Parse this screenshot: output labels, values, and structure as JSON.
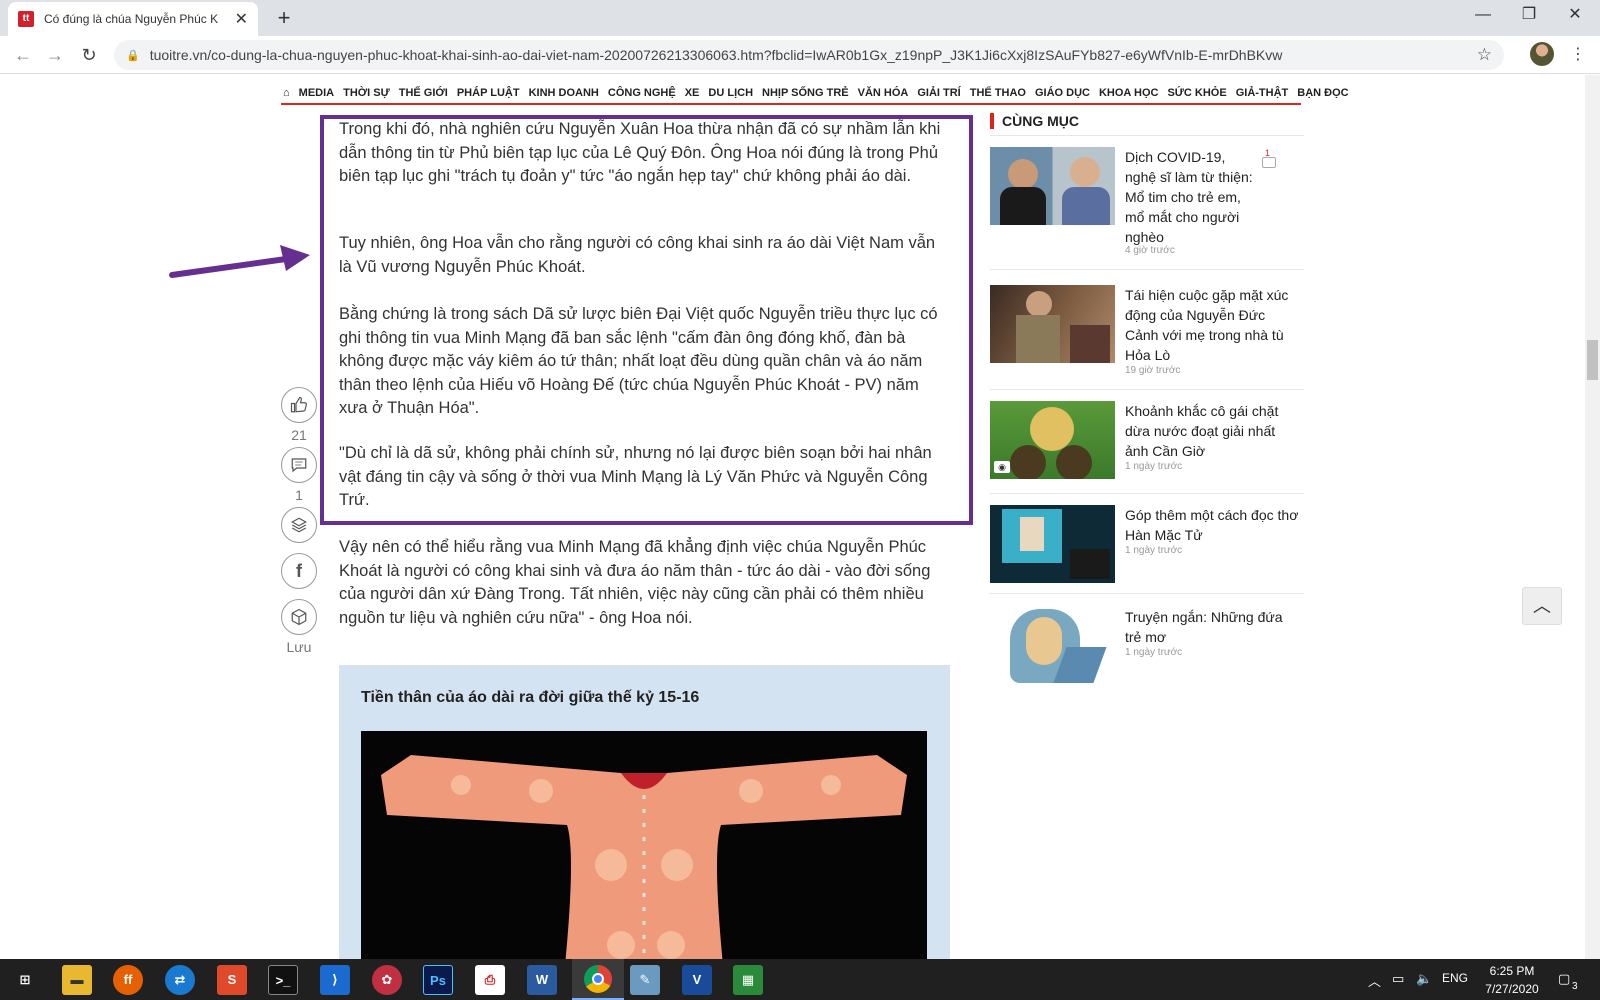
{
  "browser": {
    "tab_title": "Có đúng là chúa Nguyễn Phúc K",
    "url": "tuoitre.vn/co-dung-la-chua-nguyen-phuc-khoat-khai-sinh-ao-dai-viet-nam-20200726213306063.htm?fbclid=IwAR0b1Gx_z19npP_J3K1Ji6cXxj8IzSAuFYb827-e6yWfVnIb-E-mrDhBKvw"
  },
  "nav": {
    "items": [
      "MEDIA",
      "THỜI SỰ",
      "THẾ GIỚI",
      "PHÁP LUẬT",
      "KINH DOANH",
      "CÔNG NGHỆ",
      "XE",
      "DU LỊCH",
      "NHỊP SỐNG TRẺ",
      "VĂN HÓA",
      "GIẢI TRÍ",
      "THỂ THAO",
      "GIÁO DỤC",
      "KHOA HỌC",
      "SỨC KHỎE",
      "GIẢ-THẬT",
      "BẠN ĐỌC"
    ]
  },
  "article": {
    "paragraphs": [
      "Trong khi đó, nhà nghiên cứu Nguyễn Xuân Hoa thừa nhận đã có sự nhầm lẫn khi dẫn thông tin từ Phủ biên tạp lục của Lê Quý Đôn. Ông Hoa nói đúng là trong Phủ biên tạp lục ghi \"trách tụ đoản y\" tức \"áo ngắn hẹp tay\" chứ không phải áo dài.",
      "Tuy nhiên, ông Hoa vẫn cho rằng người có công khai sinh ra áo dài Việt Nam vẫn là Vũ vương Nguyễn Phúc Khoát.",
      "Bằng chứng là trong sách Dã sử lược biên Đại Việt quốc Nguyễn triều thực lục có ghi thông tin vua Minh Mạng đã ban sắc lệnh \"cấm đàn ông đóng khố, đàn bà không được mặc váy kiêm áo tứ thân; nhất loạt đều dùng quần chân và áo năm thân theo lệnh của Hiếu võ Hoàng Đế (tức chúa Nguyễn Phúc Khoát - PV) năm xưa ở Thuận Hóa\".",
      "\"Dù chỉ là dã sử, không phải chính sử, nhưng nó lại được biên soạn bởi hai nhân vật đáng tin cậy và sống ở thời vua Minh Mạng là Lý Văn Phức và Nguyễn Công Trứ.",
      "Vậy nên có thể hiểu rằng vua Minh Mạng đã khẳng định việc chúa Nguyễn Phúc Khoát là người có công khai sinh và đưa áo năm thân - tức áo dài - vào đời sống của người dân xứ Đàng Trong. Tất nhiên, việc này cũng cần phải có thêm nhiều nguồn tư liệu và nghiên cứu nữa\" - ông Hoa nói."
    ],
    "box_title": "Tiền thân của áo dài ra đời giữa thế kỷ 15-16"
  },
  "share": {
    "like_count": "21",
    "comment_count": "1",
    "save_label": "Lưu"
  },
  "sidebar": {
    "heading": "CÙNG MỤC",
    "comment_badge": "1",
    "items": [
      {
        "title": "Dịch COVID-19, nghệ sĩ làm từ thiện: Mổ tim cho trẻ em, mổ mắt cho người nghèo",
        "time": "4 giờ trước"
      },
      {
        "title": "Tái hiện cuộc gặp mặt xúc động của Nguyễn Đức Cảnh với mẹ trong nhà tù Hỏa Lò",
        "time": "19 giờ trước"
      },
      {
        "title": "Khoảnh khắc cô gái chặt dừa nước đoạt giải nhất ảnh Cần Giờ",
        "time": "1 ngày trước"
      },
      {
        "title": "Góp thêm một cách đọc thơ Hàn Mặc Tử",
        "time": "1 ngày trước"
      },
      {
        "title": "Truyện ngắn: Những đứa trẻ mơ",
        "time": "1 ngày trước"
      }
    ]
  },
  "taskbar": {
    "lang": "ENG",
    "time": "6:25 PM",
    "date": "7/27/2020",
    "notif_count": "3"
  }
}
